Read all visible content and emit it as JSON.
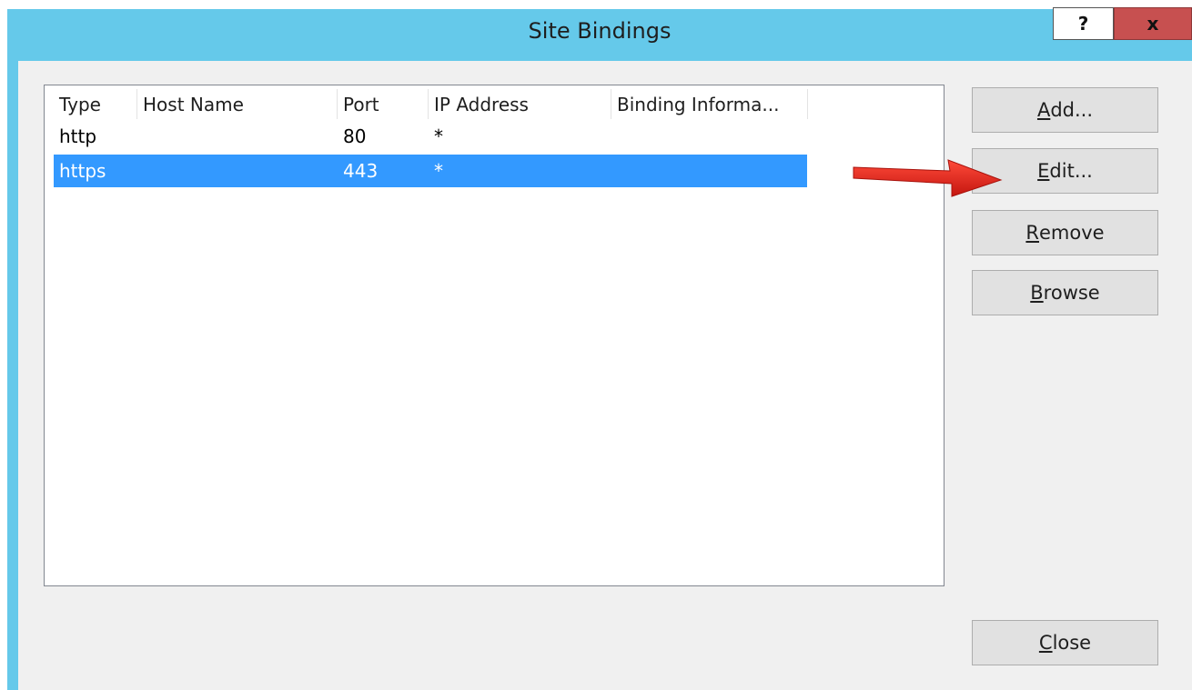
{
  "window": {
    "title": "Site Bindings",
    "help_label": "?",
    "close_label": "x"
  },
  "bindings": {
    "columns": [
      "Type",
      "Host Name",
      "Port",
      "IP Address",
      "Binding Informa..."
    ],
    "rows": [
      {
        "type": "http",
        "host": "",
        "port": "80",
        "ip": "*",
        "info": "",
        "selected": false
      },
      {
        "type": "https",
        "host": "",
        "port": "443",
        "ip": "*",
        "info": "",
        "selected": true
      }
    ]
  },
  "buttons": {
    "add": {
      "accel": "A",
      "rest": "dd..."
    },
    "edit": {
      "accel": "E",
      "rest": "dit..."
    },
    "remove": {
      "accel": "R",
      "rest": "emove"
    },
    "browse": {
      "accel": "B",
      "rest": "rowse"
    },
    "close": {
      "accel": "C",
      "rest": "lose"
    }
  },
  "colors": {
    "titlebar": "#65c9ea",
    "selection": "#3399ff",
    "arrow": "#e8241c",
    "close_button": "#c75050"
  },
  "icons": {
    "annotation_arrow": "red-arrow-pointing-right"
  }
}
